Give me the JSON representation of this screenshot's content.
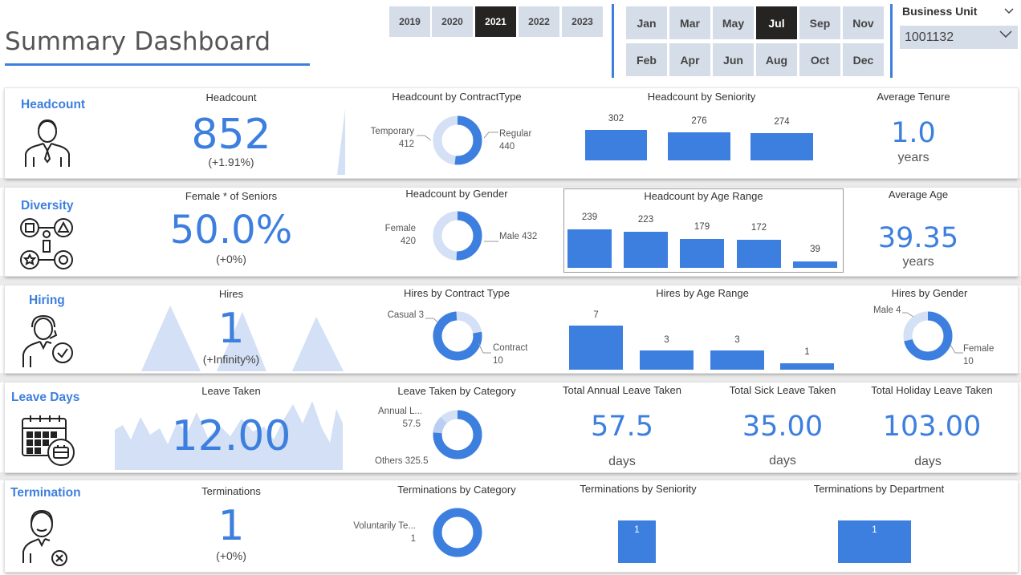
{
  "header": {
    "title": "Summary Dashboard",
    "years": [
      "2019",
      "2020",
      "2021",
      "2022",
      "2023"
    ],
    "selected_year": "2021",
    "months_top": [
      "Jan",
      "Mar",
      "May",
      "Jul",
      "Sep",
      "Nov"
    ],
    "months_bottom": [
      "Feb",
      "Apr",
      "Jun",
      "Aug",
      "Oct",
      "Dec"
    ],
    "selected_month": "Jul",
    "business_unit_label": "Business Unit",
    "business_unit_value": "1001132"
  },
  "headcount": {
    "section": "Headcount",
    "kpi_label": "Headcount",
    "kpi_value": "852",
    "kpi_change": "(+1.91%)",
    "contract_title": "Headcount by ContractType",
    "contract_left_name": "Temporary",
    "contract_left_val": "412",
    "contract_right_name": "Regular",
    "contract_right_val": "440",
    "seniority_title": "Headcount by Seniority",
    "seniority_values": [
      "302",
      "276",
      "274"
    ],
    "tenure_label": "Average Tenure",
    "tenure_value": "1.0",
    "tenure_unit": "years"
  },
  "diversity": {
    "section": "Diversity",
    "kpi_label": "Female * of Seniors",
    "kpi_value": "50.0%",
    "kpi_change": "(+0%)",
    "gender_title": "Headcount by Gender",
    "gender_left_name": "Female",
    "gender_left_val": "420",
    "gender_right": "Male 432",
    "age_title": "Headcount by Age Range",
    "age_values": [
      "239",
      "223",
      "179",
      "172",
      "39"
    ],
    "avg_age_label": "Average Age",
    "avg_age_value": "39.35",
    "avg_age_unit": "years"
  },
  "hiring": {
    "section": "Hiring",
    "kpi_label": "Hires",
    "kpi_value": "1",
    "kpi_change": "(+Infinity%)",
    "contract_title": "Hires by Contract Type",
    "contract_left": "Casual 3",
    "contract_right_name": "Contract",
    "contract_right_val": "10",
    "age_title": "Hires by Age Range",
    "age_values": [
      "7",
      "3",
      "3",
      "1"
    ],
    "gender_title": "Hires by Gender",
    "gender_left": "Male 4",
    "gender_right_name": "Female",
    "gender_right_val": "10"
  },
  "leave": {
    "section": "Leave Days",
    "kpi_label": "Leave Taken",
    "kpi_value": "12.00",
    "category_title": "Leave Taken by Category",
    "category_left_name": "Annual L...",
    "category_left_val": "57.5",
    "category_bottom": "Others 325.5",
    "annual_label": "Total Annual Leave Taken",
    "annual_value": "57.5",
    "annual_unit": "days",
    "sick_label": "Total Sick Leave Taken",
    "sick_value": "35.00",
    "sick_unit": "days",
    "holiday_label": "Total Holiday Leave Taken",
    "holiday_value": "103.00",
    "holiday_unit": "days"
  },
  "termination": {
    "section": "Termination",
    "kpi_label": "Terminations",
    "kpi_value": "1",
    "kpi_change": "(+0%)",
    "category_title": "Terminations by Category",
    "category_left_name": "Voluntarily Te...",
    "category_left_val": "1",
    "seniority_title": "Terminations by Seniority",
    "seniority_value": "1",
    "department_title": "Terminations by Department",
    "department_value": "1"
  },
  "colors": {
    "accent": "#3d7fdf",
    "light": "#d3e0f5",
    "selected": "#252423",
    "slicer": "#d5dde8"
  }
}
